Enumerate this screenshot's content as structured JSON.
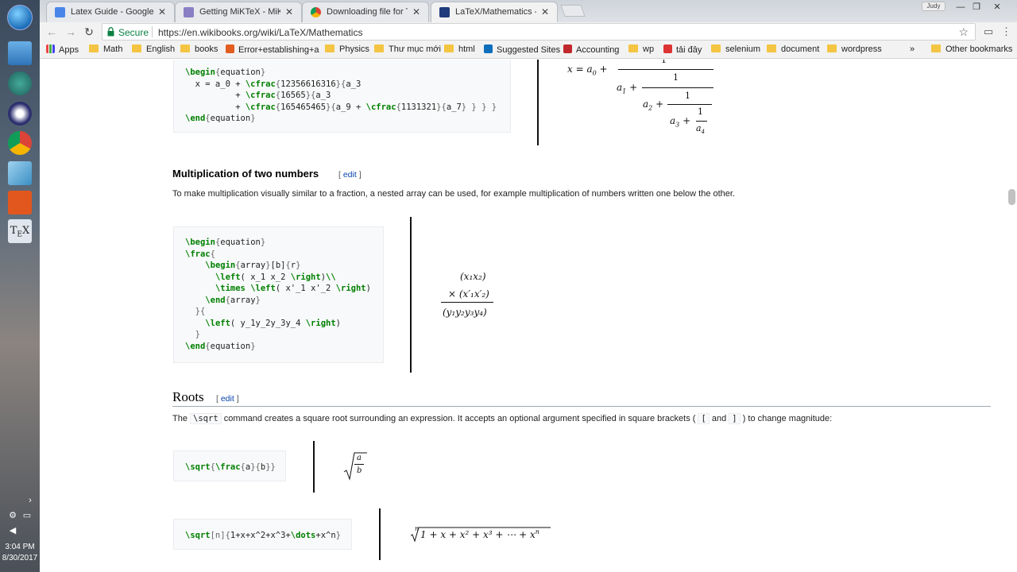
{
  "taskbar": {
    "clock_time": "3:04 PM",
    "clock_date": "8/30/2017",
    "apps": [
      "windows-explorer",
      "chat-app",
      "eclipse",
      "chrome",
      "notes-app",
      "paint-app",
      "tex-app"
    ]
  },
  "tabs": [
    {
      "title": "Latex Guide - Google Tài",
      "active": false
    },
    {
      "title": "Getting MiKTeX - MiKTeX",
      "active": false
    },
    {
      "title": "Downloading file for Tex",
      "active": false
    },
    {
      "title": "LaTeX/Mathematics - Wi",
      "active": true
    }
  ],
  "window": {
    "user": "Judy"
  },
  "toolbar": {
    "secure_label": "Secure",
    "url": "https://en.wikibooks.org/wiki/LaTeX/Mathematics"
  },
  "bookmarks": {
    "items": [
      "Apps",
      "Math",
      "English",
      "books",
      "Error+establishing+a",
      "Physics",
      "Thư mục mới",
      "html",
      "Suggested Sites",
      "Accounting",
      "wp",
      "tải đây",
      "selenium",
      "document",
      "wordpress"
    ],
    "overflow": "»",
    "other": "Other bookmarks"
  },
  "content": {
    "code1": [
      "\\begin{equation}",
      "  x = a_0 + \\cfrac{12356616316}{a_3",
      "          + \\cfrac{16565}{a_3",
      "          + \\cfrac{165465465}{a_9 + \\cfrac{1131321}{a_7} } } }",
      "\\end{equation}"
    ],
    "math1": {
      "lhs": "x = a",
      "lhs_sub": "0",
      "plus": "+",
      "one": "1",
      "a1": "a",
      "a1_sub": "1",
      "a2": "a",
      "a2_sub": "2",
      "a3": "a",
      "a3_sub": "3",
      "a4": "a",
      "a4_sub": "4"
    },
    "section1": {
      "heading": "Multiplication of two numbers",
      "edit": "edit",
      "para": "To make multiplication visually similar to a fraction, a nested array can be used, for example multiplication of numbers written one below the other."
    },
    "code2": [
      "\\begin{equation}",
      "\\frac{",
      "    \\begin{array}[b]{r}",
      "      \\left( x_1 x_2 \\right)\\\\",
      "      \\times \\left( x'_1 x'_2 \\right)",
      "    \\end{array}",
      "  }{",
      "    \\left( y_1y_2y_3y_4 \\right)",
      "  }",
      "\\end{equation}"
    ],
    "math2": {
      "top": "(x₁x₂)",
      "mid": "× (x′₁x′₂)",
      "bottom": "(y₁y₂y₃y₄)"
    },
    "section2": {
      "heading": "Roots",
      "edit": "edit",
      "para_pre": "The",
      "para_code": "\\sqrt",
      "para_mid": "command creates a square root surrounding an expression. It accepts an optional argument specified in square brackets (",
      "para_code2": "[",
      "para_and": "and",
      "para_code3": "]",
      "para_post": ") to change magnitude:"
    },
    "code3": "\\sqrt{\\frac{a}{b}}",
    "math3": {
      "num": "a",
      "den": "b"
    },
    "code4": "\\sqrt[n]{1+x+x^2+x^3+\\dots+x^n}",
    "math4": {
      "index": "n",
      "body": "1 + x + x² + x³ + ⋯ + x",
      "sup": "n"
    }
  }
}
